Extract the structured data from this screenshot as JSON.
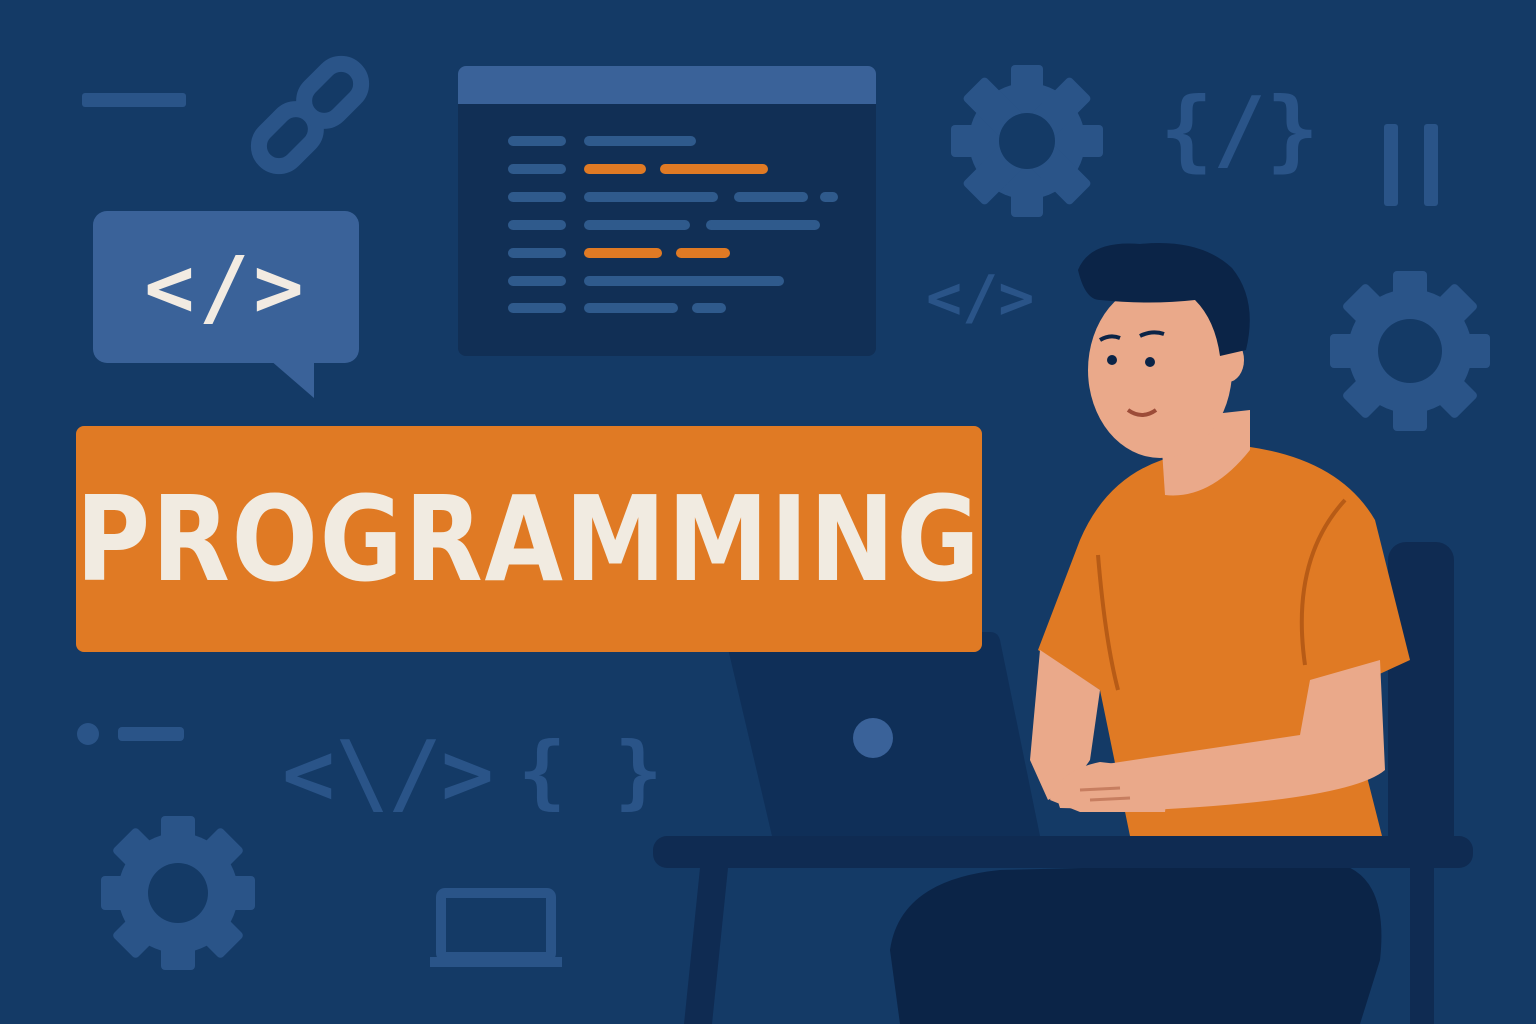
{
  "banner": {
    "title": "PROGRAMMING"
  },
  "code_bubble": {
    "text": "</>"
  },
  "decorations": {
    "tag_right": "</>",
    "tag_bottom": "<\\/>",
    "braces_bottom": "{ }",
    "braces_top": "{/}"
  },
  "icons": {
    "link": "link-icon",
    "gear": "gear-icon",
    "laptop": "laptop-icon"
  },
  "colors": {
    "background": "#143a66",
    "accent_orange": "#e07a24",
    "bubble_blue": "#3a6299",
    "deco_blue": "#2a5488",
    "text_cream": "#f1ebe1"
  }
}
